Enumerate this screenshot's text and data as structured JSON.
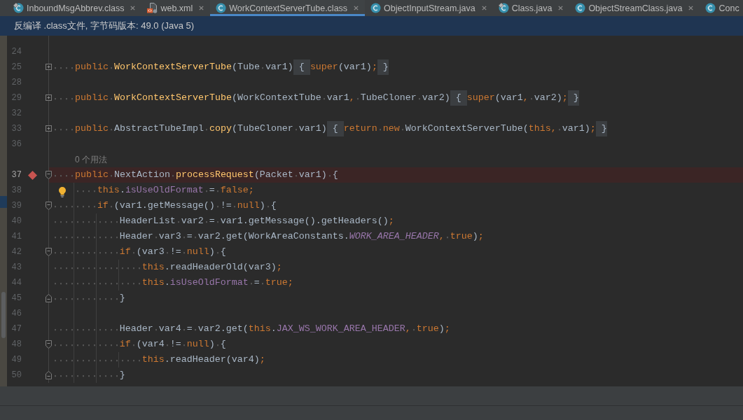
{
  "tabs": [
    {
      "label": "InboundMsgAbbrev.class",
      "kind": "class",
      "badge": true,
      "closable": true,
      "selected": false
    },
    {
      "label": "web.xml",
      "kind": "xml",
      "badge": false,
      "closable": true,
      "selected": false
    },
    {
      "label": "WorkContextServerTube.class",
      "kind": "class",
      "badge": false,
      "closable": true,
      "selected": true
    },
    {
      "label": "ObjectInputStream.java",
      "kind": "class",
      "badge": false,
      "closable": true,
      "selected": false
    },
    {
      "label": "Class.java",
      "kind": "class",
      "badge": true,
      "closable": true,
      "selected": false
    },
    {
      "label": "ObjectStreamClass.java",
      "kind": "class",
      "badge": false,
      "closable": true,
      "selected": false
    },
    {
      "label": "Conc",
      "kind": "class",
      "badge": false,
      "closable": false,
      "selected": false
    }
  ],
  "banner": {
    "text": "反编译 .class文件, 字节码版本: 49.0 (Java 5)"
  },
  "editor": {
    "lines": [
      {
        "kind": "code",
        "number": "24",
        "breakpoint": false,
        "current": false,
        "bulb": false
      },
      {
        "kind": "code",
        "number": "25",
        "breakpoint": false,
        "current": false,
        "bulb": false,
        "fold": {
          "kind": "collapsed"
        },
        "tokens": [
          {
            "kind": "keyword",
            "text": "    public "
          },
          {
            "kind": "method",
            "text": "WorkContextServerTube"
          },
          {
            "kind": "plain",
            "text": "(Tube var1)"
          },
          {
            "kind": "fold",
            "text": " { "
          },
          {
            "kind": "keyword",
            "text": "super"
          },
          {
            "kind": "plain",
            "text": "(var1)"
          },
          {
            "kind": "keyword",
            "text": ";"
          },
          {
            "kind": "fold",
            "text": " }"
          }
        ]
      },
      {
        "kind": "code",
        "number": "28",
        "breakpoint": false,
        "current": false,
        "bulb": false
      },
      {
        "kind": "code",
        "number": "29",
        "breakpoint": false,
        "current": false,
        "bulb": false,
        "fold": {
          "kind": "collapsed"
        },
        "tokens": [
          {
            "kind": "keyword",
            "text": "    public "
          },
          {
            "kind": "method",
            "text": "WorkContextServerTube"
          },
          {
            "kind": "plain",
            "text": "(WorkContextTube var1"
          },
          {
            "kind": "keyword",
            "text": ","
          },
          {
            "kind": "plain",
            "text": " TubeCloner var2)"
          },
          {
            "kind": "fold",
            "text": " { "
          },
          {
            "kind": "keyword",
            "text": "super"
          },
          {
            "kind": "plain",
            "text": "(var1"
          },
          {
            "kind": "keyword",
            "text": ","
          },
          {
            "kind": "plain",
            "text": " var2)"
          },
          {
            "kind": "keyword",
            "text": ";"
          },
          {
            "kind": "fold",
            "text": " }"
          }
        ]
      },
      {
        "kind": "code",
        "number": "32",
        "breakpoint": false,
        "current": false,
        "bulb": false
      },
      {
        "kind": "code",
        "number": "33",
        "breakpoint": false,
        "current": false,
        "bulb": false,
        "fold": {
          "kind": "collapsed"
        },
        "tokens": [
          {
            "kind": "keyword",
            "text": "    public"
          },
          {
            "kind": "plain",
            "text": " AbstractTubeImpl "
          },
          {
            "kind": "method",
            "text": "copy"
          },
          {
            "kind": "plain",
            "text": "(TubeCloner var1)"
          },
          {
            "kind": "fold",
            "text": " { "
          },
          {
            "kind": "keyword",
            "text": "return new"
          },
          {
            "kind": "plain",
            "text": " WorkContextServerTube("
          },
          {
            "kind": "keyword",
            "text": "this,"
          },
          {
            "kind": "plain",
            "text": " var1)"
          },
          {
            "kind": "keyword",
            "text": ";"
          },
          {
            "kind": "fold",
            "text": " }"
          }
        ]
      },
      {
        "kind": "code",
        "number": "36",
        "breakpoint": false,
        "current": false,
        "bulb": false
      },
      {
        "kind": "hint",
        "text": "0 个用法"
      },
      {
        "kind": "code",
        "number": "37",
        "breakpoint": true,
        "current": true,
        "bulb": false,
        "fold": {
          "kind": "open"
        },
        "tokens": [
          {
            "kind": "keyword",
            "text": "    public"
          },
          {
            "kind": "plain",
            "text": " NextAction "
          },
          {
            "kind": "method",
            "text": "processRequest"
          },
          {
            "kind": "plain",
            "text": "(Packet var1) {"
          }
        ]
      },
      {
        "kind": "code",
        "number": "38",
        "breakpoint": false,
        "current": false,
        "bulb": true,
        "tokens": [
          {
            "kind": "keyword",
            "text": "        this"
          },
          {
            "kind": "plain",
            "text": "."
          },
          {
            "kind": "field",
            "text": "isUseOldFormat"
          },
          {
            "kind": "plain",
            "text": " = "
          },
          {
            "kind": "keyword",
            "text": "false;"
          }
        ]
      },
      {
        "kind": "code",
        "number": "39",
        "breakpoint": false,
        "current": false,
        "bulb": false,
        "fold": {
          "kind": "open"
        },
        "tokens": [
          {
            "kind": "keyword",
            "text": "        if"
          },
          {
            "kind": "plain",
            "text": " (var1.getMessage() != "
          },
          {
            "kind": "keyword",
            "text": "null"
          },
          {
            "kind": "plain",
            "text": ") {"
          }
        ]
      },
      {
        "kind": "code",
        "number": "40",
        "breakpoint": false,
        "current": false,
        "bulb": false,
        "tokens": [
          {
            "kind": "plain",
            "text": "            HeaderList var2 = var1.getMessage().getHeaders()"
          },
          {
            "kind": "keyword",
            "text": ";"
          }
        ]
      },
      {
        "kind": "code",
        "number": "41",
        "breakpoint": false,
        "current": false,
        "bulb": false,
        "tokens": [
          {
            "kind": "plain",
            "text": "            Header var3 = var2.get(WorkAreaConstants."
          },
          {
            "kind": "static",
            "text": "WORK_AREA_HEADER"
          },
          {
            "kind": "keyword",
            "text": ", true"
          },
          {
            "kind": "plain",
            "text": ")"
          },
          {
            "kind": "keyword",
            "text": ";"
          }
        ]
      },
      {
        "kind": "code",
        "number": "42",
        "breakpoint": false,
        "current": false,
        "bulb": false,
        "fold": {
          "kind": "open"
        },
        "tokens": [
          {
            "kind": "keyword",
            "text": "            if"
          },
          {
            "kind": "plain",
            "text": " (var3 != "
          },
          {
            "kind": "keyword",
            "text": "null"
          },
          {
            "kind": "plain",
            "text": ") {"
          }
        ]
      },
      {
        "kind": "code",
        "number": "43",
        "breakpoint": false,
        "current": false,
        "bulb": false,
        "tokens": [
          {
            "kind": "keyword",
            "text": "                this"
          },
          {
            "kind": "plain",
            "text": ".readHeaderOld(var3)"
          },
          {
            "kind": "keyword",
            "text": ";"
          }
        ]
      },
      {
        "kind": "code",
        "number": "44",
        "breakpoint": false,
        "current": false,
        "bulb": false,
        "tokens": [
          {
            "kind": "keyword",
            "text": "                this"
          },
          {
            "kind": "plain",
            "text": "."
          },
          {
            "kind": "field",
            "text": "isUseOldFormat"
          },
          {
            "kind": "plain",
            "text": " = "
          },
          {
            "kind": "keyword",
            "text": "true;"
          }
        ]
      },
      {
        "kind": "code",
        "number": "45",
        "breakpoint": false,
        "current": false,
        "bulb": false,
        "fold": {
          "kind": "end"
        },
        "tokens": [
          {
            "kind": "plain",
            "text": "            }"
          }
        ]
      },
      {
        "kind": "code",
        "number": "46",
        "breakpoint": false,
        "current": false,
        "bulb": false
      },
      {
        "kind": "code",
        "number": "47",
        "breakpoint": false,
        "current": false,
        "bulb": false,
        "tokens": [
          {
            "kind": "plain",
            "text": "            Header var4 = var2.get("
          },
          {
            "kind": "keyword",
            "text": "this"
          },
          {
            "kind": "plain",
            "text": "."
          },
          {
            "kind": "field",
            "text": "JAX_WS_WORK_AREA_HEADER"
          },
          {
            "kind": "keyword",
            "text": ", true"
          },
          {
            "kind": "plain",
            "text": ")"
          },
          {
            "kind": "keyword",
            "text": ";"
          }
        ]
      },
      {
        "kind": "code",
        "number": "48",
        "breakpoint": false,
        "current": false,
        "bulb": false,
        "fold": {
          "kind": "open"
        },
        "tokens": [
          {
            "kind": "keyword",
            "text": "            if"
          },
          {
            "kind": "plain",
            "text": " (var4 != "
          },
          {
            "kind": "keyword",
            "text": "null"
          },
          {
            "kind": "plain",
            "text": ") {"
          }
        ]
      },
      {
        "kind": "code",
        "number": "49",
        "breakpoint": false,
        "current": false,
        "bulb": false,
        "tokens": [
          {
            "kind": "keyword",
            "text": "                this"
          },
          {
            "kind": "plain",
            "text": ".readHeader(var4)"
          },
          {
            "kind": "keyword",
            "text": ";"
          }
        ]
      },
      {
        "kind": "code",
        "number": "50",
        "breakpoint": false,
        "current": false,
        "bulb": false,
        "fold": {
          "kind": "end"
        },
        "tokens": [
          {
            "kind": "plain",
            "text": "            }"
          }
        ]
      }
    ]
  }
}
